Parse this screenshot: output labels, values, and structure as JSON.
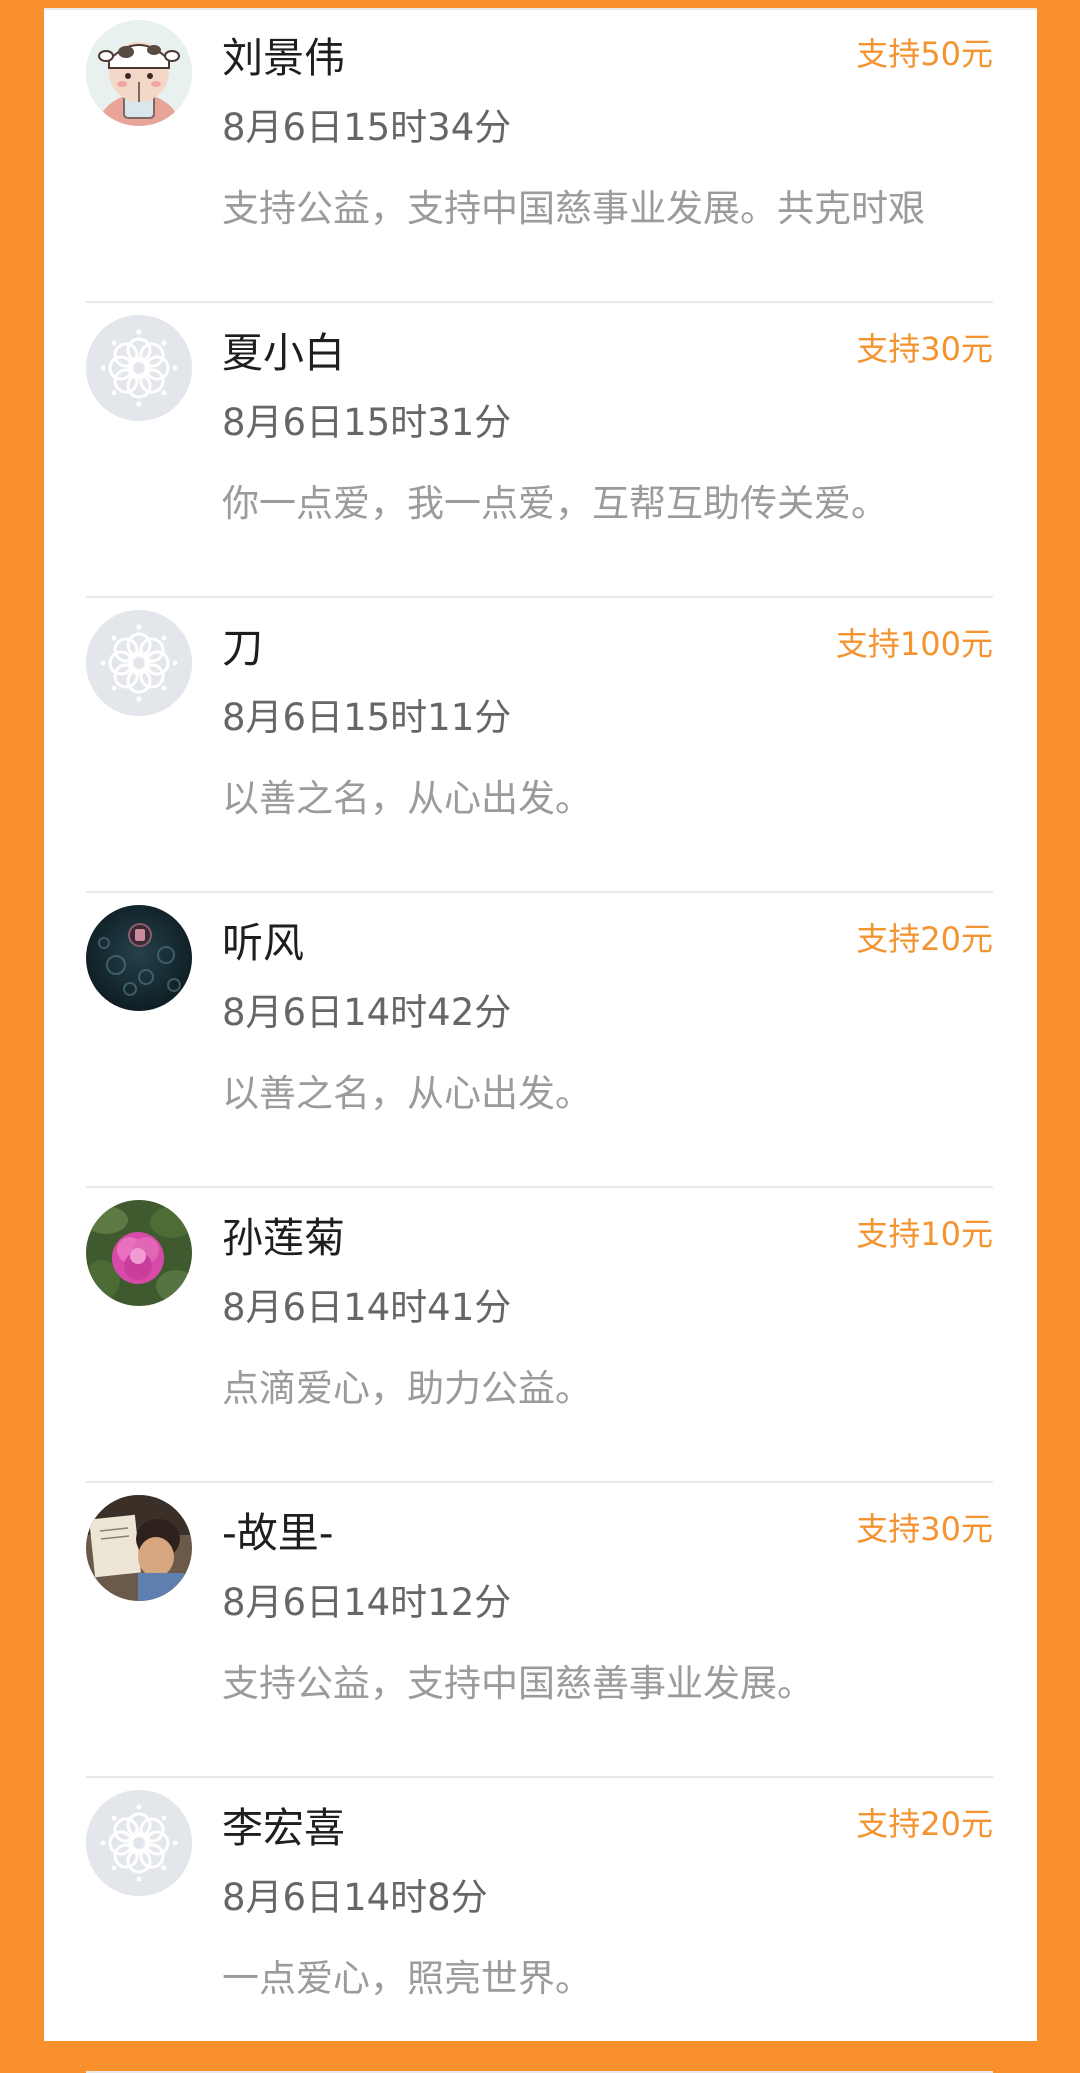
{
  "colors": {
    "background_accent": "#F7902D",
    "card": "#FFFFFF",
    "amount_text": "#F39431",
    "name_text": "#1E1E1E",
    "time_text": "#666666",
    "message_text": "#9B9B9B",
    "divider": "#E9E9E9"
  },
  "supporters": [
    {
      "name": "刘景伟",
      "time": "8月6日15时34分",
      "message": "支持公益，支持中国慈事业发展。共克时艰",
      "amount": "支持50元",
      "avatar": "cartoon-cow-avatar"
    },
    {
      "name": "夏小白",
      "time": "8月6日15时31分",
      "message": "你一点爱，我一点爱，互帮互助传关爱。",
      "amount": "支持30元",
      "avatar": "default-flower-avatar"
    },
    {
      "name": "刀",
      "time": "8月6日15时11分",
      "message": "以善之名，从心出发。",
      "amount": "支持100元",
      "avatar": "default-flower-avatar"
    },
    {
      "name": "听风",
      "time": "8月6日14时42分",
      "message": "以善之名，从心出发。",
      "amount": "支持20元",
      "avatar": "dark-bubbles-avatar"
    },
    {
      "name": "孙莲菊",
      "time": "8月6日14时41分",
      "message": "点滴爱心，助力公益。",
      "amount": "支持10元",
      "avatar": "pink-peony-avatar"
    },
    {
      "name": "-故里-",
      "time": "8月6日14时12分",
      "message": "支持公益，支持中国慈善事业发展。",
      "amount": "支持30元",
      "avatar": "child-reading-avatar"
    },
    {
      "name": "李宏喜",
      "time": "8月6日14时8分",
      "message": "一点爱心，照亮世界。",
      "amount": "支持20元",
      "avatar": "default-flower-avatar"
    }
  ]
}
